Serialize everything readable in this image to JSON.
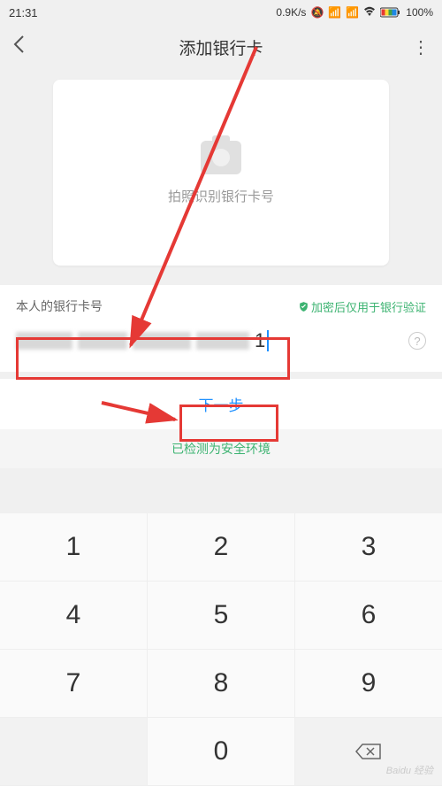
{
  "status_bar": {
    "time": "21:31",
    "speed": "0.9K/s",
    "battery": "100%"
  },
  "nav": {
    "title": "添加银行卡"
  },
  "photo_card": {
    "label": "拍照识别银行卡号"
  },
  "input_section": {
    "label": "本人的银行卡号",
    "security": "加密后仅用于银行验证",
    "visible_digit": "1"
  },
  "next_button": {
    "label": "下一步"
  },
  "env_check": {
    "label": "已检测为安全环境"
  },
  "keypad": {
    "rows": [
      [
        "1",
        "2",
        "3"
      ],
      [
        "4",
        "5",
        "6"
      ],
      [
        "7",
        "8",
        "9"
      ],
      [
        "",
        "0",
        "⌫"
      ]
    ]
  },
  "watermark": "Baidu 经验"
}
